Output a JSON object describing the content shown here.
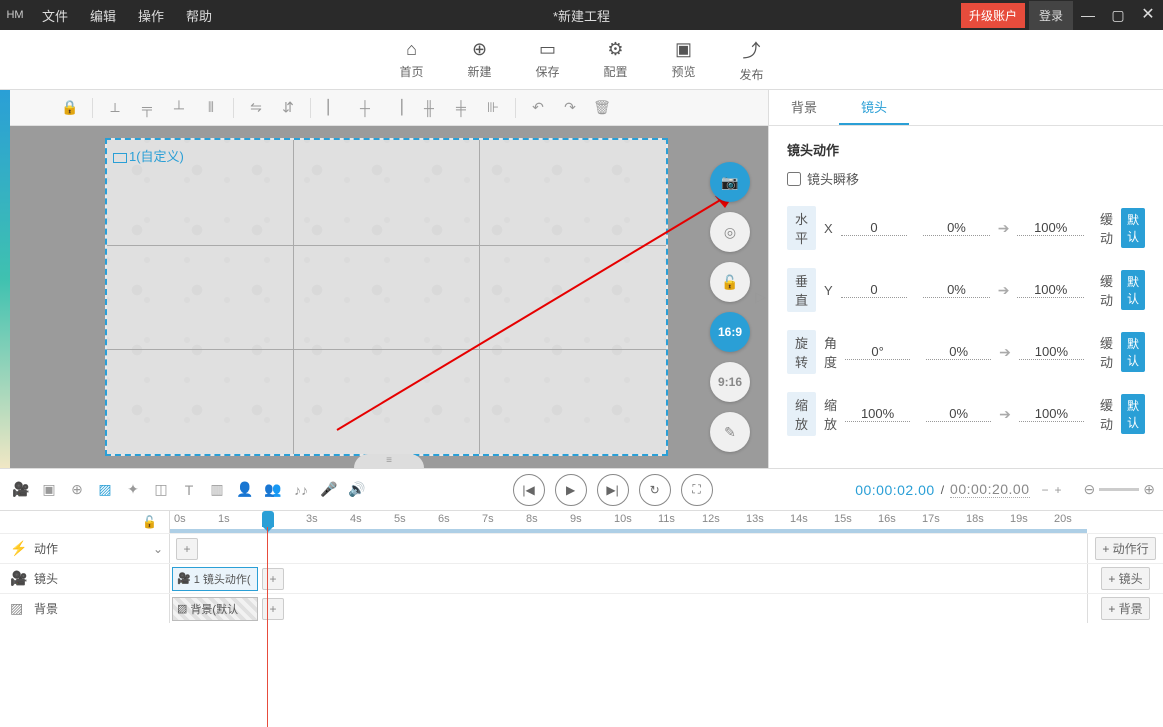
{
  "titlebar": {
    "logo": "НM",
    "menus": [
      "文件",
      "编辑",
      "操作",
      "帮助"
    ],
    "title": "*新建工程",
    "upgrade": "升级账户",
    "login": "登录"
  },
  "topToolbar": [
    {
      "icon": "⌂",
      "label": "首页",
      "name": "home-button"
    },
    {
      "icon": "⊕",
      "label": "新建",
      "name": "new-button"
    },
    {
      "icon": "▭",
      "label": "保存",
      "name": "save-button"
    },
    {
      "icon": "⚙",
      "label": "配置",
      "name": "config-button"
    },
    {
      "icon": "▣",
      "label": "预览",
      "name": "preview-button"
    },
    {
      "icon": "⤴",
      "label": "发布",
      "name": "publish-button"
    }
  ],
  "canvas": {
    "frameLabel": "1(自定义)",
    "floatButtons": {
      "aspect169": "16:9",
      "aspect916": "9:16"
    }
  },
  "rightPanel": {
    "tabs": {
      "bg": "背景",
      "camera": "镜头"
    },
    "sectionTitle": "镜头动作",
    "instantLabel": "镜头瞬移",
    "rows": [
      {
        "tag": "水平",
        "field": "X",
        "val": "0",
        "from": "0%",
        "to": "100%"
      },
      {
        "tag": "垂直",
        "field": "Y",
        "val": "0",
        "from": "0%",
        "to": "100%"
      },
      {
        "tag": "旋转",
        "field": "角度",
        "val": "0°",
        "from": "0%",
        "to": "100%"
      },
      {
        "tag": "缩放",
        "field": "缩放",
        "val": "100%",
        "from": "0%",
        "to": "100%"
      }
    ],
    "ease": "缓动",
    "defaultPill": "默认"
  },
  "playback": {
    "current": "00:00:02.00",
    "total": "00:00:20.00"
  },
  "timelineHeader": {
    "ticks": [
      "0s",
      "1s",
      "2s",
      "3s",
      "4s",
      "5s",
      "6s",
      "7s",
      "8s",
      "9s",
      "10s",
      "11s",
      "12s",
      "13s",
      "14s",
      "15s",
      "16s",
      "17s",
      "18s",
      "19s",
      "20s"
    ],
    "playheadIndex": 2
  },
  "timelineRows": {
    "action": {
      "label": "动作",
      "rightBtn": "+ 动作行"
    },
    "camera": {
      "label": "镜头",
      "clip": "1 镜头动作(",
      "rightBtn": "+ 镜头"
    },
    "bg": {
      "label": "背景",
      "clip": "背景(默认",
      "rightBtn": "+ 背景"
    }
  }
}
